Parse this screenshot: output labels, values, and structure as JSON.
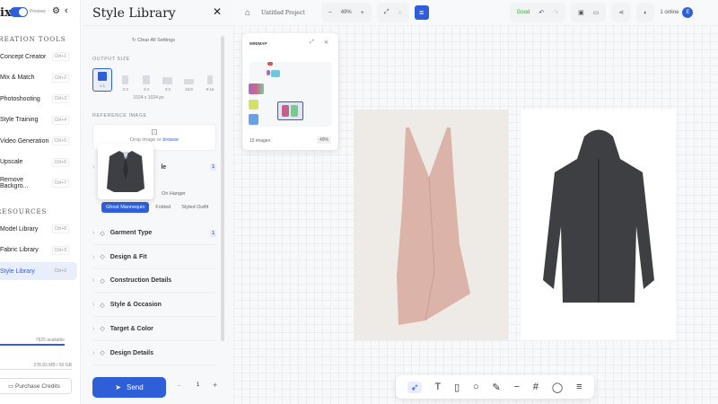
{
  "sidebar": {
    "logo": "ix",
    "preview_label": "Preview",
    "creation_title": "CREATION TOOLS",
    "creation_tools": [
      {
        "label": "Concept Creator",
        "shortcut": "Ctrl+1"
      },
      {
        "label": "Mix & Match",
        "shortcut": "Ctrl+2"
      },
      {
        "label": "Photoshooting",
        "shortcut": "Ctrl+3"
      },
      {
        "label": "Style Training",
        "shortcut": "Ctrl+4"
      },
      {
        "label": "Video Generation",
        "shortcut": "Ctrl+5"
      },
      {
        "label": "Upscale",
        "shortcut": "Ctrl+6"
      },
      {
        "label": "Remove Backgro...",
        "shortcut": "Ctrl+7"
      }
    ],
    "resources_title": "RESOURCES",
    "resources": [
      {
        "label": "Model Library",
        "shortcut": "Ctrl+8"
      },
      {
        "label": "Fabric Library",
        "shortcut": "Ctrl+9"
      },
      {
        "label": "Style Library",
        "shortcut": "Ctrl+0",
        "active": true
      }
    ],
    "credits": "7825 available",
    "credits_fraction": 0.95,
    "storage": "278.83 MB / 50 GB",
    "storage_fraction": 0.01,
    "purchase": "Purchase Credits"
  },
  "panel": {
    "title": "Style Library",
    "clear": "Clear All Settings",
    "output_size_label": "OUTPUT SIZE",
    "ratios": [
      "1:1",
      "2:3",
      "3:4",
      "4:3",
      "16:9",
      "9:16"
    ],
    "selected_ratio": "1:1",
    "dimensions": "1024 x 1024 px",
    "reference_label": "REFERENCE IMAGE",
    "drop_text": "Drop image or ",
    "browse": "browse",
    "style_section_suffix": "le",
    "style_badge": "1",
    "style_options_row1": [
      "n",
      "On Hanger"
    ],
    "style_options_row2": [
      "Ghost Mannequin",
      "Folded",
      "Styled Outfit"
    ],
    "selected_style": "Ghost Mannequin",
    "sections": [
      {
        "label": "Garment Type",
        "badge": "1"
      },
      {
        "label": "Design & Fit"
      },
      {
        "label": "Construction Details"
      },
      {
        "label": "Style & Occasion"
      },
      {
        "label": "Target & Color"
      },
      {
        "label": "Design Details"
      }
    ],
    "send": "Send",
    "quantity": "1"
  },
  "topbar": {
    "project": "Untitled Project",
    "zoom": "49%",
    "status": "Good",
    "online": "1 online",
    "avatar": "E"
  },
  "minimap": {
    "title": "MINIMAP",
    "count": "15 images",
    "zoom": "49%"
  },
  "colors": {
    "accent": "#2f5fd8"
  },
  "toolbar": {
    "tools": [
      "select-icon",
      "text-icon",
      "note-icon",
      "circle-icon",
      "pen-icon",
      "line-icon",
      "frame-icon",
      "comment-icon",
      "menu-icon"
    ]
  }
}
